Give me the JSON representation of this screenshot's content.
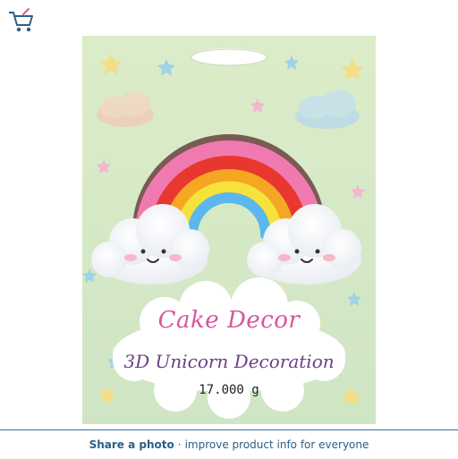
{
  "icons": {
    "cart": "cart-icon"
  },
  "product": {
    "package_line1": "Cake Decor",
    "package_line2": "3D Unicorn Decoration",
    "weight": "17.000 g"
  },
  "share_bar": {
    "cta": "Share a photo",
    "separator": "·",
    "message": "improve product info for everyone"
  },
  "colors": {
    "card_green": "#d7e9c9",
    "rainbow_pink": "#f07ab0",
    "rainbow_red": "#e8372f",
    "rainbow_orange": "#f5a623",
    "rainbow_yellow": "#f6e23a",
    "rainbow_blue": "#5bb7ee",
    "link_blue": "#2d5f86"
  }
}
